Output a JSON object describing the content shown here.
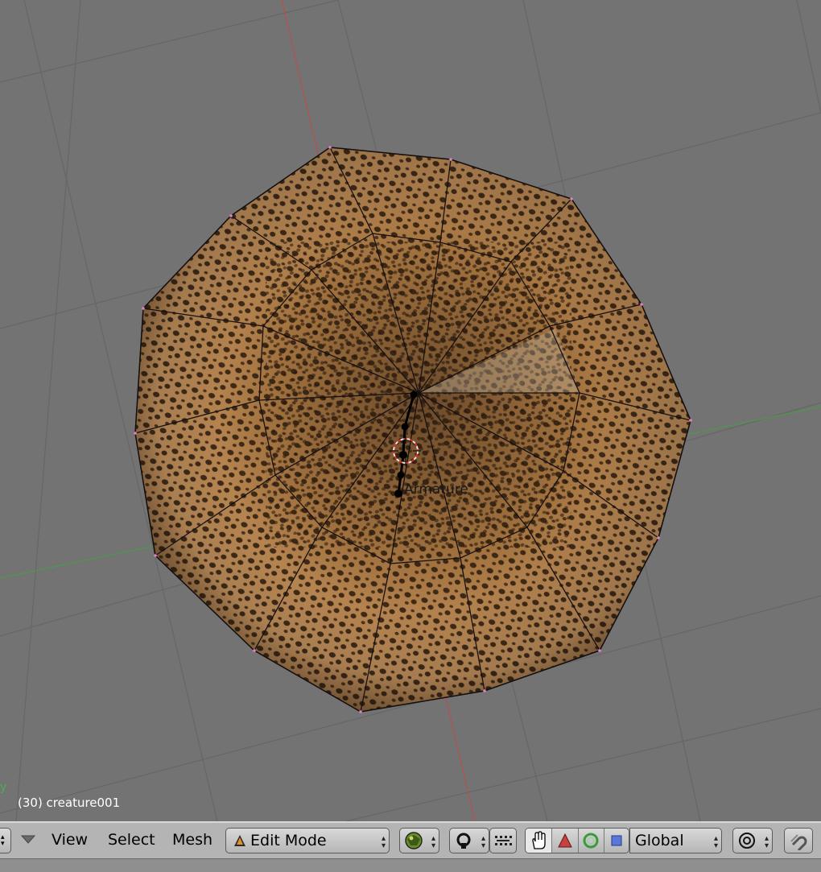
{
  "viewport": {
    "object_info": "(30) creature001",
    "axis_y_label": "y",
    "armature_label": "Armature"
  },
  "header": {
    "menus": {
      "view": "View",
      "select": "Select",
      "mesh": "Mesh"
    },
    "mode_select": {
      "value": "Edit Mode",
      "icon": "edit-mode-triangle-icon"
    },
    "draw_type_icon": "textured-sphere-icon",
    "pivot_icon": "pivot-point-icon",
    "manipulator_icons": [
      "hand-grab-icon",
      "translate-arrow-icon",
      "rotate-ring-icon",
      "scale-square-icon"
    ],
    "orientation_select": {
      "value": "Global"
    },
    "proportional_icon": "proportional-edit-icon",
    "snap_icon": "magnet-icon"
  },
  "colors": {
    "background": "#737373",
    "grid": "#666666",
    "x_axis": "#c0504d",
    "y_axis": "#4caf50",
    "header": "#b4b4b4"
  }
}
